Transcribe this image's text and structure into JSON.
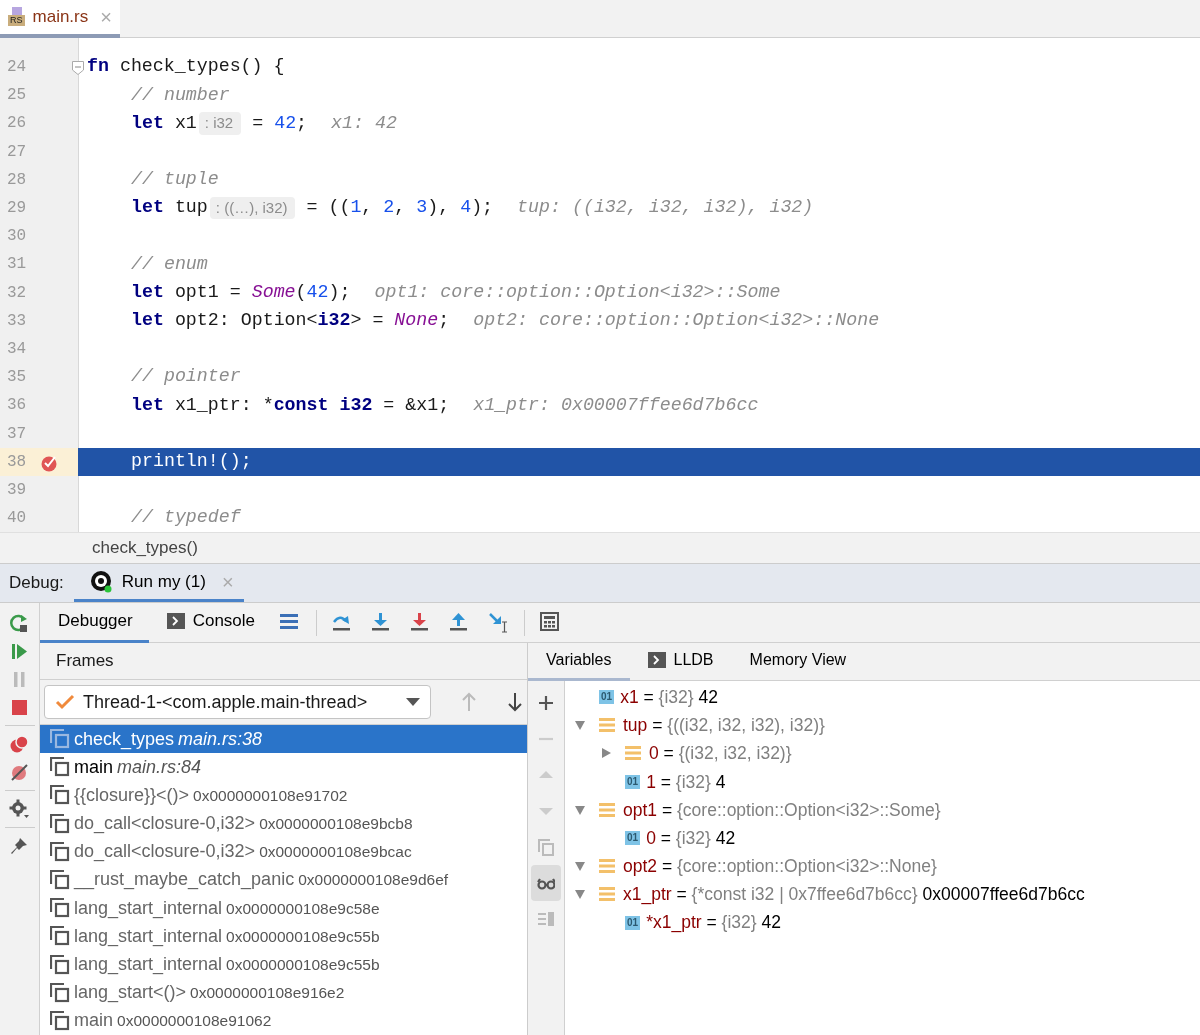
{
  "file_tab": {
    "icon_text": "RS",
    "label": "main.rs",
    "close": "×",
    "selected": true
  },
  "code_lines": [
    {
      "number": "24",
      "fold": true,
      "breakpoint": false,
      "current": false,
      "segments": [
        {
          "kind": "code",
          "parts": [
            {
              "kind": "keyword",
              "text": "fn"
            },
            {
              "kind": "plain",
              "text": " check_types() {"
            }
          ]
        }
      ],
      "children": [
        {
          "number": "25",
          "fold": false,
          "breakpoint": false,
          "current": false,
          "segments": [
            {
              "kind": "code",
              "parts": [
                {
                  "kind": "comment",
                  "text": "// number"
                }
              ]
            }
          ]
        },
        {
          "number": "26",
          "fold": false,
          "breakpoint": false,
          "current": false,
          "segments": [
            {
              "kind": "code",
              "parts": [
                {
                  "kind": "keyword",
                  "text": "let"
                },
                {
                  "kind": "plain",
                  "text": " x1"
                }
              ]
            },
            {
              "kind": "inlay",
              "text": ": i32"
            },
            {
              "kind": "code",
              "parts": [
                {
                  "kind": "plain",
                  "text": "= "
                },
                {
                  "kind": "number",
                  "text": "42"
                },
                {
                  "kind": "plain",
                  "text": ";"
                }
              ]
            },
            {
              "kind": "value",
              "text": "x1: 42"
            }
          ]
        },
        {
          "number": "27",
          "fold": false,
          "breakpoint": false,
          "current": false
        },
        {
          "number": "28",
          "fold": false,
          "breakpoint": false,
          "current": false,
          "segments": [
            {
              "kind": "code",
              "parts": [
                {
                  "kind": "comment",
                  "text": "// tuple"
                }
              ]
            }
          ]
        },
        {
          "number": "29",
          "fold": false,
          "breakpoint": false,
          "current": false,
          "segments": [
            {
              "kind": "code",
              "parts": [
                {
                  "kind": "keyword",
                  "text": "let"
                },
                {
                  "kind": "plain",
                  "text": " tup"
                }
              ]
            },
            {
              "kind": "inlay",
              "text": ": ((…), i32)"
            },
            {
              "kind": "code",
              "parts": [
                {
                  "kind": "plain",
                  "text": "= (("
                },
                {
                  "kind": "number",
                  "text": "1"
                },
                {
                  "kind": "plain",
                  "text": ", "
                },
                {
                  "kind": "number",
                  "text": "2"
                },
                {
                  "kind": "plain",
                  "text": ", "
                },
                {
                  "kind": "number",
                  "text": "3"
                },
                {
                  "kind": "plain",
                  "text": "), "
                },
                {
                  "kind": "number",
                  "text": "4"
                },
                {
                  "kind": "plain",
                  "text": ");"
                }
              ]
            },
            {
              "kind": "value",
              "text": "tup: ((i32, i32, i32), i32)"
            }
          ]
        },
        {
          "number": "30",
          "fold": false,
          "breakpoint": false,
          "current": false
        },
        {
          "number": "31",
          "fold": false,
          "breakpoint": false,
          "current": false,
          "segments": [
            {
              "kind": "code",
              "parts": [
                {
                  "kind": "comment",
                  "text": "// enum"
                }
              ]
            }
          ]
        },
        {
          "number": "32",
          "fold": false,
          "breakpoint": false,
          "current": false,
          "segments": [
            {
              "kind": "code",
              "parts": [
                {
                  "kind": "keyword",
                  "text": "let"
                },
                {
                  "kind": "plain",
                  "text": " opt1 = "
                },
                {
                  "kind": "variant",
                  "text": "Some"
                },
                {
                  "kind": "plain",
                  "text": "("
                },
                {
                  "kind": "number",
                  "text": "42"
                },
                {
                  "kind": "plain",
                  "text": ");"
                }
              ]
            },
            {
              "kind": "value",
              "text": "opt1: core::option::Option<i32>::Some"
            }
          ]
        },
        {
          "number": "33",
          "fold": false,
          "breakpoint": false,
          "current": false,
          "segments": [
            {
              "kind": "code",
              "parts": [
                {
                  "kind": "keyword",
                  "text": "let"
                },
                {
                  "kind": "plain",
                  "text": " opt2: Option<"
                },
                {
                  "kind": "keyword",
                  "text": "i32"
                },
                {
                  "kind": "plain",
                  "text": "> = "
                },
                {
                  "kind": "variant",
                  "text": "None"
                },
                {
                  "kind": "plain",
                  "text": ";"
                }
              ]
            },
            {
              "kind": "value",
              "text": "opt2: core::option::Option<i32>::None"
            }
          ]
        },
        {
          "number": "34",
          "fold": false,
          "breakpoint": false,
          "current": false
        },
        {
          "number": "35",
          "fold": false,
          "breakpoint": false,
          "current": false,
          "segments": [
            {
              "kind": "code",
              "parts": [
                {
                  "kind": "comment",
                  "text": "// pointer"
                }
              ]
            }
          ]
        },
        {
          "number": "36",
          "fold": false,
          "breakpoint": false,
          "current": false,
          "segments": [
            {
              "kind": "code",
              "parts": [
                {
                  "kind": "keyword",
                  "text": "let"
                },
                {
                  "kind": "plain",
                  "text": " x1_ptr: *"
                },
                {
                  "kind": "keyword",
                  "text": "const i32"
                },
                {
                  "kind": "plain",
                  "text": " = &x1;"
                }
              ]
            },
            {
              "kind": "value",
              "text": "x1_ptr: 0x00007ffee6d7b6cc"
            }
          ]
        },
        {
          "number": "37",
          "fold": false,
          "breakpoint": false,
          "current": false
        },
        {
          "number": "38",
          "fold": false,
          "breakpoint": true,
          "current": true,
          "segments": [
            {
              "kind": "code",
              "parts": [
                {
                  "kind": "plain",
                  "text": "println!();"
                }
              ]
            }
          ]
        },
        {
          "number": "39",
          "fold": false,
          "breakpoint": false,
          "current": false
        },
        {
          "number": "40",
          "fold": false,
          "breakpoint": false,
          "current": false,
          "segments": [
            {
              "kind": "code",
              "parts": [
                {
                  "kind": "comment",
                  "text": "// typedef"
                }
              ]
            }
          ]
        }
      ]
    }
  ],
  "breadcrumb": "check_types()",
  "debug_bar": {
    "label": "Debug:",
    "session": {
      "label": "Run my (1)",
      "close": "×",
      "selected": true
    }
  },
  "tool_tabs": [
    {
      "label": "Debugger",
      "kind": "plain",
      "selected": true
    },
    {
      "label": "Console",
      "kind": "console",
      "selected": false
    }
  ],
  "frames": {
    "header": "Frames",
    "thread": "Thread-1-<com.apple.main-thread>",
    "items": [
      {
        "name": "check_types",
        "location": "main.rs:38",
        "kind": "source",
        "selected": true
      },
      {
        "name": "main",
        "location": "main.rs:84",
        "kind": "source",
        "selected": false
      },
      {
        "name": "{{closure}}<()>",
        "location": "0x0000000108e91702",
        "kind": "address",
        "selected": false
      },
      {
        "name": "do_call<closure-0,i32>",
        "location": "0x0000000108e9bcb8",
        "kind": "address",
        "selected": false
      },
      {
        "name": "do_call<closure-0,i32>",
        "location": "0x0000000108e9bcac",
        "kind": "address",
        "selected": false
      },
      {
        "name": "__rust_maybe_catch_panic",
        "location": "0x0000000108e9d6ef",
        "kind": "address",
        "selected": false
      },
      {
        "name": "lang_start_internal",
        "location": "0x0000000108e9c58e",
        "kind": "address",
        "selected": false
      },
      {
        "name": "lang_start_internal",
        "location": "0x0000000108e9c55b",
        "kind": "address",
        "selected": false
      },
      {
        "name": "lang_start_internal",
        "location": "0x0000000108e9c55b",
        "kind": "address",
        "selected": false
      },
      {
        "name": "lang_start<()>",
        "location": "0x0000000108e916e2",
        "kind": "address",
        "selected": false
      },
      {
        "name": "main",
        "location": "0x0000000108e91062",
        "kind": "address",
        "selected": false
      }
    ]
  },
  "variable_tabs": [
    {
      "label": "Variables",
      "kind": "plain",
      "selected": true
    },
    {
      "label": "LLDB",
      "kind": "console",
      "selected": false
    },
    {
      "label": "Memory View",
      "kind": "plain",
      "selected": false
    }
  ],
  "variables": [
    {
      "kind": "primitive",
      "badge": "01",
      "name": "x1",
      "eq": "=",
      "type": "{i32}",
      "value": "42"
    },
    {
      "kind": "struct",
      "expanded": true,
      "name": "tup",
      "eq": "=",
      "type": "{((i32, i32, i32), i32)}",
      "children": [
        {
          "kind": "struct",
          "expanded": false,
          "name": "0",
          "eq": "=",
          "type": "{(i32, i32, i32)}"
        },
        {
          "kind": "primitive",
          "badge": "01",
          "name": "1",
          "eq": "=",
          "type": "{i32}",
          "value": "4"
        }
      ]
    },
    {
      "kind": "struct",
      "expanded": true,
      "name": "opt1",
      "eq": "=",
      "type": "{core::option::Option<i32>::Some}",
      "children": [
        {
          "kind": "primitive",
          "badge": "01",
          "name": "0",
          "eq": "=",
          "type": "{i32}",
          "value": "42"
        }
      ]
    },
    {
      "kind": "struct",
      "expanded": true,
      "name": "opt2",
      "eq": "=",
      "type": "{core::option::Option<i32>::None}"
    },
    {
      "kind": "struct",
      "expanded": true,
      "name": "x1_ptr",
      "eq": "=",
      "type": "{*const i32 | 0x7ffee6d7b6cc}",
      "value": "0x00007ffee6d7b6cc",
      "children": [
        {
          "kind": "primitive",
          "badge": "01",
          "name": "*x1_ptr",
          "eq": "=",
          "type": "{i32}",
          "value": "42"
        }
      ]
    }
  ]
}
